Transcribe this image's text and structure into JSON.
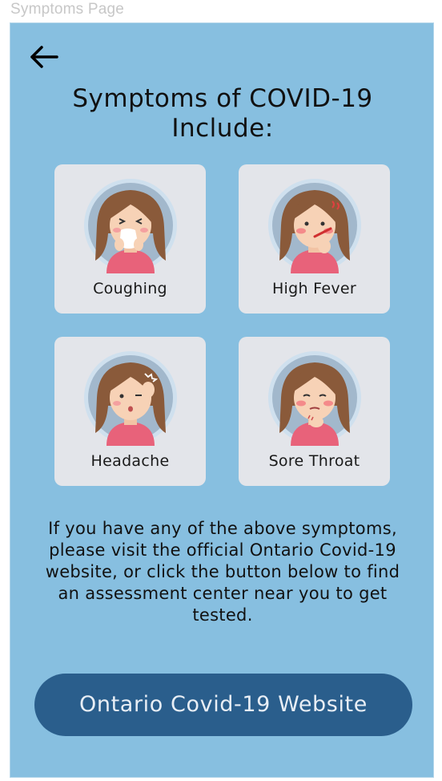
{
  "frame_label": "Symptoms Page",
  "icons": {
    "back": "arrow-left-icon"
  },
  "title": "Symptoms of COVID-19 Include:",
  "symptoms": [
    {
      "label": "Coughing",
      "icon": "coughing-girl-icon"
    },
    {
      "label": "High Fever",
      "icon": "fever-girl-icon"
    },
    {
      "label": "Headache",
      "icon": "headache-girl-icon"
    },
    {
      "label": "Sore Throat",
      "icon": "sore-throat-girl-icon"
    }
  ],
  "info_text": "If you have any of the above symptoms, please visit the official Ontario Covid-19 website, or click the button below to find an assessment center near you to get tested.",
  "cta_label": "Ontario Covid-19 Website",
  "colors": {
    "background": "#87bfe0",
    "card": "#e3e5ea",
    "button": "#2a5e8c",
    "button_text": "#e8eef5"
  }
}
